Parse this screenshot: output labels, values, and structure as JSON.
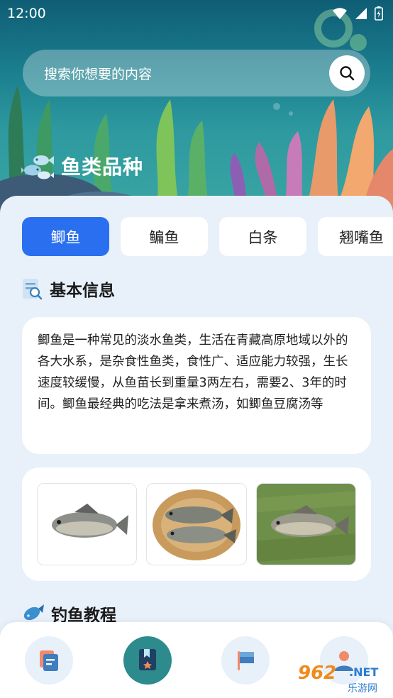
{
  "status_bar": {
    "time": "12:00"
  },
  "search": {
    "placeholder": "搜索你想要的内容"
  },
  "hero": {
    "section_title": "鱼类品种"
  },
  "tabs": [
    {
      "label": "鲫鱼",
      "active": true
    },
    {
      "label": "鳊鱼",
      "active": false
    },
    {
      "label": "白条",
      "active": false
    },
    {
      "label": "翘嘴鱼",
      "active": false
    }
  ],
  "basic_info": {
    "title": "基本信息",
    "text": "鲫鱼是一种常见的淡水鱼类，生活在青藏高原地域以外的各大水系，是杂食性鱼类，食性广、适应能力较强，生长速度较缓慢，从鱼苗长到重量3两左右，需要2、3年的时间。鲫鱼最经典的吃法是拿来煮汤，如鲫鱼豆腐汤等"
  },
  "photos": [
    {
      "alt": "fish-on-white"
    },
    {
      "alt": "fish-on-basket"
    },
    {
      "alt": "fish-on-grass"
    }
  ],
  "tutorial": {
    "title": "钓鱼教程"
  },
  "bottom_nav": [
    {
      "icon": "document-icon",
      "active": false
    },
    {
      "icon": "bookmark-icon",
      "active": true
    },
    {
      "icon": "flag-icon",
      "active": false
    },
    {
      "icon": "profile-icon",
      "active": false
    }
  ],
  "watermark": {
    "number": "962",
    "suffix": ".NET",
    "text": "乐游网"
  },
  "colors": {
    "accent": "#2a6ff0",
    "teal": "#2d8a8d",
    "panel": "#e8f0fa"
  }
}
